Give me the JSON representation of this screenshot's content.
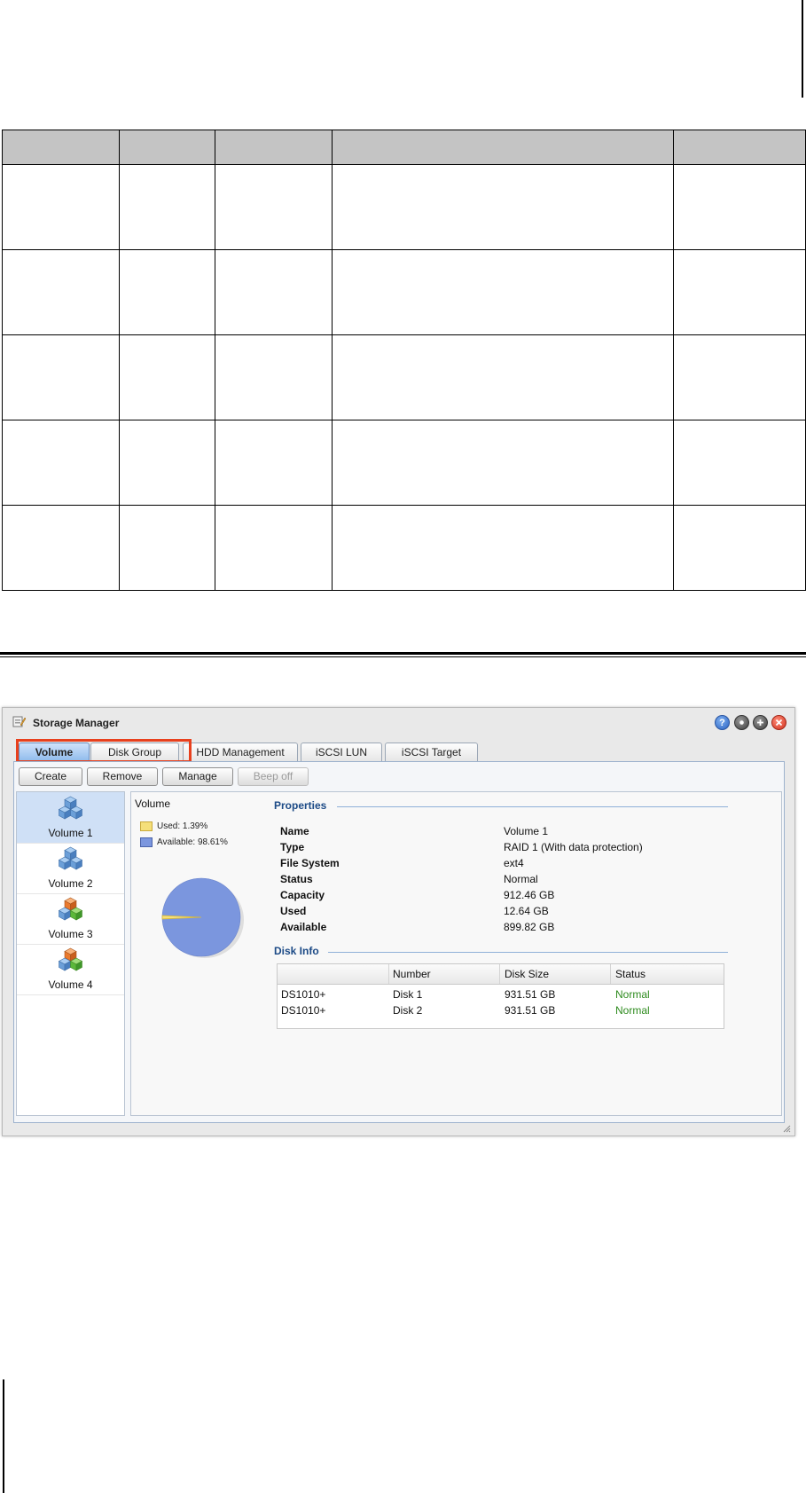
{
  "window": {
    "title": "Storage Manager",
    "buttons": {
      "help": "?"
    }
  },
  "tabs": [
    {
      "label": "Volume",
      "active": true
    },
    {
      "label": "Disk Group",
      "active": false
    },
    {
      "label": "HDD Management",
      "active": false
    },
    {
      "label": "iSCSI LUN",
      "active": false
    },
    {
      "label": "iSCSI Target",
      "active": false
    }
  ],
  "toolbar": {
    "create": "Create",
    "remove": "Remove",
    "manage": "Manage",
    "beep_off": "Beep off"
  },
  "volumes": [
    {
      "label": "Volume 1",
      "selected": true,
      "icon": "cube-blue-icon"
    },
    {
      "label": "Volume 2",
      "selected": false,
      "icon": "cube-blue-icon"
    },
    {
      "label": "Volume 3",
      "selected": false,
      "icon": "cube-multicolor-icon"
    },
    {
      "label": "Volume 4",
      "selected": false,
      "icon": "cube-multicolor-icon"
    }
  ],
  "usage": {
    "title": "Volume",
    "used_label": "Used: 1.39%",
    "available_label": "Available: 98.61%",
    "used_color": "#f5df7a",
    "available_color": "#7b96de",
    "used_fraction": 0.0139
  },
  "properties": {
    "heading": "Properties",
    "rows": [
      {
        "key": "Name",
        "value": "Volume 1"
      },
      {
        "key": "Type",
        "value": "RAID 1 (With data protection)"
      },
      {
        "key": "File System",
        "value": "ext4"
      },
      {
        "key": "Status",
        "value": "Normal"
      },
      {
        "key": "Capacity",
        "value": "912.46 GB"
      },
      {
        "key": "Used",
        "value": "12.64 GB"
      },
      {
        "key": "Available",
        "value": "899.82 GB"
      }
    ]
  },
  "disk_info": {
    "heading": "Disk Info",
    "columns": [
      "",
      "Number",
      "Disk Size",
      "Status"
    ],
    "rows": [
      [
        "DS1010+",
        "Disk 1",
        "931.51 GB",
        "Normal"
      ],
      [
        "DS1010+",
        "Disk 2",
        "931.51 GB",
        "Normal"
      ]
    ],
    "status_color": "#2e8b1e"
  }
}
